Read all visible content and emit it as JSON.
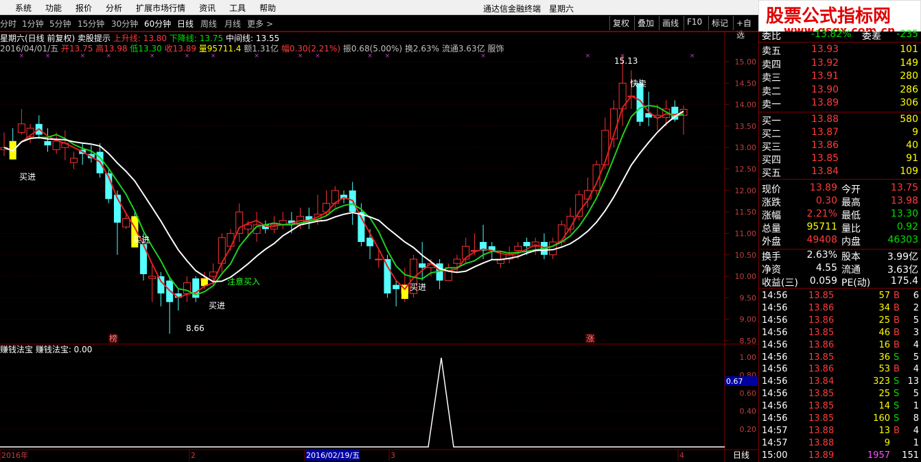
{
  "menubar": {
    "items": [
      "系统",
      "功能",
      "报价",
      "分析",
      "扩展市场行情",
      "资讯",
      "工具",
      "帮助"
    ],
    "title": "通达信金融终端",
    "day": "星期六"
  },
  "logo": {
    "main": "股票公式指标网",
    "sub": "www.gsgx.com.cn"
  },
  "periods": {
    "items": [
      "分时",
      "1分钟",
      "5分钟",
      "15分钟",
      "30分钟",
      "60分钟",
      "日线",
      "周线",
      "月线",
      "更多 >"
    ],
    "active": "日线"
  },
  "tools": [
    "复权",
    "叠加",
    "画线",
    "F10",
    "标记",
    "+自选"
  ],
  "info": {
    "title": "星期六(日线 前复权)",
    "indicator_name": "卖股提示",
    "up_label": "上升线: 13.80",
    "down_label": "下降线: 13.75",
    "mid_label": "中间线: 13.55",
    "date": "2016/04/01/五",
    "open": "开13.75",
    "high": "高13.98",
    "low": "低13.30",
    "close": "收13.89",
    "volume": "量95711.4",
    "amount": "额1.31亿",
    "range": "幅0.30(2.21%)",
    "amplitude": "振0.68(5.00%)",
    "turnover": "换2.63%",
    "float": "流通3.63亿",
    "industry": "服饰"
  },
  "price_axis": [
    "15.00",
    "14.50",
    "14.00",
    "13.50",
    "13.00",
    "12.50",
    "12.00",
    "11.50",
    "11.00",
    "10.50",
    "10.00",
    "9.50",
    "9.00",
    "8.50"
  ],
  "lower": {
    "title": "赚钱法宝",
    "label": "赚钱法宝: 0.00",
    "axis": [
      "1.00",
      "0.80",
      "0.60",
      "0.40",
      "0.20"
    ],
    "marker": "0.67"
  },
  "annotations": {
    "buy": "买进",
    "sell": "快卖",
    "attention": "注意买入",
    "high_mark": "15.13",
    "low_mark": "8.66",
    "tag1": "榜",
    "tag2": "涨"
  },
  "time_axis": {
    "labels": [
      "2016年",
      "2",
      "2016/02/19/五",
      "3",
      "4"
    ],
    "period_label": "日线"
  },
  "quote": {
    "partial_top": {
      "label": "委比",
      "value": "-13.82%",
      "label2": "委差",
      "value2": "-235"
    },
    "asks": [
      {
        "label": "卖五",
        "price": "13.93",
        "vol": "101"
      },
      {
        "label": "卖四",
        "price": "13.92",
        "vol": "149"
      },
      {
        "label": "卖三",
        "price": "13.91",
        "vol": "280"
      },
      {
        "label": "卖二",
        "price": "13.90",
        "vol": "286"
      },
      {
        "label": "卖一",
        "price": "13.89",
        "vol": "306"
      }
    ],
    "bids": [
      {
        "label": "买一",
        "price": "13.88",
        "vol": "580"
      },
      {
        "label": "买二",
        "price": "13.87",
        "vol": "9"
      },
      {
        "label": "买三",
        "price": "13.86",
        "vol": "40"
      },
      {
        "label": "买四",
        "price": "13.85",
        "vol": "91"
      },
      {
        "label": "买五",
        "price": "13.84",
        "vol": "109"
      }
    ],
    "stats": [
      {
        "l1": "现价",
        "v1": "13.89",
        "c1": "red",
        "l2": "今开",
        "v2": "13.75",
        "c2": "red"
      },
      {
        "l1": "涨跌",
        "v1": "0.30",
        "c1": "red",
        "l2": "最高",
        "v2": "13.98",
        "c2": "red"
      },
      {
        "l1": "涨幅",
        "v1": "2.21%",
        "c1": "red",
        "l2": "最低",
        "v2": "13.30",
        "c2": "green"
      },
      {
        "l1": "总量",
        "v1": "95711",
        "c1": "yellow",
        "l2": "量比",
        "v2": "0.92",
        "c2": "green"
      },
      {
        "l1": "外盘",
        "v1": "49408",
        "c1": "red",
        "l2": "内盘",
        "v2": "46303",
        "c2": "green"
      }
    ],
    "stats2": [
      {
        "l1": "换手",
        "v1": "2.63%",
        "l2": "股本",
        "v2": "3.99亿"
      },
      {
        "l1": "净资",
        "v1": "4.55",
        "l2": "流通",
        "v2": "3.63亿"
      },
      {
        "l1": "收益(三)",
        "v1": "0.059",
        "l2": "PE(动)",
        "v2": "175.4"
      }
    ],
    "ticks": [
      {
        "t": "14:56",
        "p": "13.85",
        "v": "57",
        "s": "B",
        "n": "6"
      },
      {
        "t": "14:56",
        "p": "13.86",
        "v": "34",
        "s": "B",
        "n": "2"
      },
      {
        "t": "14:56",
        "p": "13.86",
        "v": "25",
        "s": "B",
        "n": "5"
      },
      {
        "t": "14:56",
        "p": "13.85",
        "v": "46",
        "s": "B",
        "n": "3"
      },
      {
        "t": "14:56",
        "p": "13.86",
        "v": "16",
        "s": "B",
        "n": "4"
      },
      {
        "t": "14:56",
        "p": "13.85",
        "v": "36",
        "s": "S",
        "n": "5"
      },
      {
        "t": "14:56",
        "p": "13.86",
        "v": "53",
        "s": "B",
        "n": "4"
      },
      {
        "t": "14:56",
        "p": "13.84",
        "v": "323",
        "s": "S",
        "n": "13"
      },
      {
        "t": "14:56",
        "p": "13.85",
        "v": "25",
        "s": "S",
        "n": "5"
      },
      {
        "t": "14:56",
        "p": "13.85",
        "v": "14",
        "s": "S",
        "n": "1"
      },
      {
        "t": "14:56",
        "p": "13.85",
        "v": "160",
        "s": "S",
        "n": "8"
      },
      {
        "t": "14:57",
        "p": "13.88",
        "v": "13",
        "s": "B",
        "n": "4"
      },
      {
        "t": "14:57",
        "p": "13.88",
        "v": "9",
        "s": "",
        "n": "1"
      },
      {
        "t": "15:00",
        "p": "13.89",
        "v": "1957",
        "s": "",
        "n": "151"
      }
    ]
  },
  "chart_data": {
    "type": "candlestick",
    "ylim": [
      8.5,
      15.0
    ],
    "candles": [
      [
        12.95,
        13.0,
        12.8,
        13.35
      ],
      [
        13.15,
        12.85,
        12.8,
        13.45
      ],
      [
        13.35,
        13.55,
        13.3,
        13.9
      ],
      [
        13.25,
        13.45,
        13.1,
        13.55
      ],
      [
        13.55,
        13.3,
        13.2,
        13.75
      ],
      [
        13.15,
        13.05,
        12.9,
        13.45
      ],
      [
        12.95,
        13.15,
        12.85,
        13.35
      ],
      [
        13.0,
        13.1,
        12.7,
        13.4
      ],
      [
        12.65,
        12.75,
        12.5,
        12.9
      ],
      [
        12.95,
        12.85,
        12.6,
        13.1
      ],
      [
        12.85,
        12.75,
        12.65,
        13.05
      ],
      [
        12.9,
        12.4,
        12.3,
        13.1
      ],
      [
        12.4,
        11.8,
        11.7,
        12.5
      ],
      [
        11.9,
        11.25,
        10.5,
        12.0
      ],
      [
        11.15,
        11.35,
        11.1,
        11.45
      ],
      [
        11.4,
        10.8,
        10.7,
        11.55
      ],
      [
        10.75,
        10.05,
        9.9,
        11.0
      ],
      [
        9.95,
        10.0,
        9.4,
        10.3
      ],
      [
        10.0,
        9.6,
        9.3,
        10.1
      ],
      [
        9.9,
        9.4,
        8.66,
        10.0
      ],
      [
        9.6,
        9.5,
        9.2,
        9.7
      ],
      [
        9.6,
        9.85,
        9.4,
        10.0
      ],
      [
        9.95,
        9.5,
        9.4,
        10.0
      ],
      [
        9.9,
        9.95,
        9.7,
        10.1
      ],
      [
        10.0,
        10.1,
        9.8,
        10.3
      ],
      [
        10.3,
        10.9,
        10.1,
        11.0
      ],
      [
        10.7,
        11.0,
        10.6,
        11.1
      ],
      [
        11.0,
        11.5,
        10.8,
        11.7
      ],
      [
        11.1,
        11.2,
        10.9,
        11.3
      ],
      [
        11.0,
        11.2,
        10.8,
        11.5
      ],
      [
        11.2,
        11.1,
        11.0,
        11.3
      ],
      [
        11.1,
        11.2,
        11.0,
        11.4
      ],
      [
        11.2,
        11.3,
        11.1,
        11.5
      ],
      [
        11.3,
        11.2,
        11.0,
        11.5
      ],
      [
        11.2,
        11.4,
        11.1,
        11.6
      ],
      [
        11.4,
        11.3,
        11.1,
        11.6
      ],
      [
        11.3,
        11.45,
        11.2,
        11.9
      ],
      [
        11.5,
        11.7,
        11.4,
        12.0
      ],
      [
        11.7,
        12.0,
        11.6,
        12.1
      ],
      [
        11.9,
        11.8,
        11.7,
        12.0
      ],
      [
        12.0,
        11.5,
        11.2,
        12.2
      ],
      [
        11.5,
        10.8,
        10.7,
        11.7
      ],
      [
        10.9,
        10.7,
        10.4,
        11.1
      ],
      [
        10.4,
        10.4,
        10.2,
        10.6
      ],
      [
        10.4,
        9.6,
        9.5,
        10.5
      ],
      [
        9.8,
        9.7,
        9.3,
        9.9
      ],
      [
        9.6,
        9.8,
        9.4,
        10.2
      ],
      [
        9.6,
        10.4,
        9.5,
        10.5
      ],
      [
        10.3,
        10.2,
        9.9,
        10.8
      ],
      [
        10.2,
        10.3,
        10.0,
        10.4
      ],
      [
        10.3,
        9.9,
        9.7,
        10.4
      ],
      [
        9.9,
        10.2,
        9.9,
        10.3
      ],
      [
        10.3,
        10.4,
        10.1,
        10.5
      ],
      [
        10.4,
        10.7,
        10.3,
        10.9
      ],
      [
        10.6,
        10.6,
        10.5,
        11.0
      ],
      [
        10.8,
        10.6,
        10.4,
        11.2
      ],
      [
        10.7,
        10.6,
        10.4,
        10.8
      ],
      [
        10.3,
        10.4,
        10.2,
        10.6
      ],
      [
        10.4,
        10.5,
        10.3,
        10.7
      ],
      [
        10.6,
        10.7,
        10.4,
        10.8
      ],
      [
        10.8,
        10.7,
        10.5,
        10.9
      ],
      [
        10.7,
        10.8,
        10.5,
        10.9
      ],
      [
        10.8,
        10.5,
        10.4,
        11.0
      ],
      [
        10.5,
        10.8,
        10.4,
        10.9
      ],
      [
        10.8,
        11.2,
        10.7,
        11.3
      ],
      [
        11.1,
        11.4,
        11.0,
        11.6
      ],
      [
        11.4,
        11.9,
        11.3,
        12.0
      ],
      [
        11.8,
        12.0,
        11.6,
        12.3
      ],
      [
        12.0,
        12.6,
        11.9,
        12.7
      ],
      [
        12.6,
        13.4,
        12.5,
        13.7
      ],
      [
        13.2,
        13.9,
        13.0,
        14.1
      ],
      [
        13.9,
        14.5,
        13.5,
        15.13
      ],
      [
        14.2,
        14.2,
        13.9,
        14.8
      ],
      [
        14.5,
        13.6,
        13.5,
        14.6
      ],
      [
        13.8,
        13.7,
        13.5,
        14.3
      ],
      [
        13.7,
        13.75,
        13.4,
        14.0
      ],
      [
        13.7,
        13.9,
        13.5,
        14.1
      ],
      [
        13.95,
        13.65,
        13.6,
        14.1
      ],
      [
        13.75,
        13.89,
        13.3,
        13.98
      ]
    ],
    "signal": [
      0,
      0,
      0,
      0,
      0,
      0,
      0,
      0,
      0,
      0,
      0,
      0,
      0,
      0,
      0,
      0,
      0,
      0,
      0,
      0,
      0,
      0,
      0,
      0,
      0,
      0,
      0,
      0,
      0,
      0,
      0,
      0,
      0,
      0,
      0,
      0,
      0,
      0,
      0,
      0,
      0,
      0,
      0,
      0,
      0,
      0,
      0,
      0,
      0,
      0,
      0,
      0,
      0,
      0,
      0,
      0,
      0,
      0,
      0,
      0,
      0,
      0,
      0,
      0,
      0,
      0,
      0,
      0,
      0,
      0,
      0,
      0,
      0,
      0,
      0,
      0,
      0,
      0,
      0,
      0
    ]
  }
}
